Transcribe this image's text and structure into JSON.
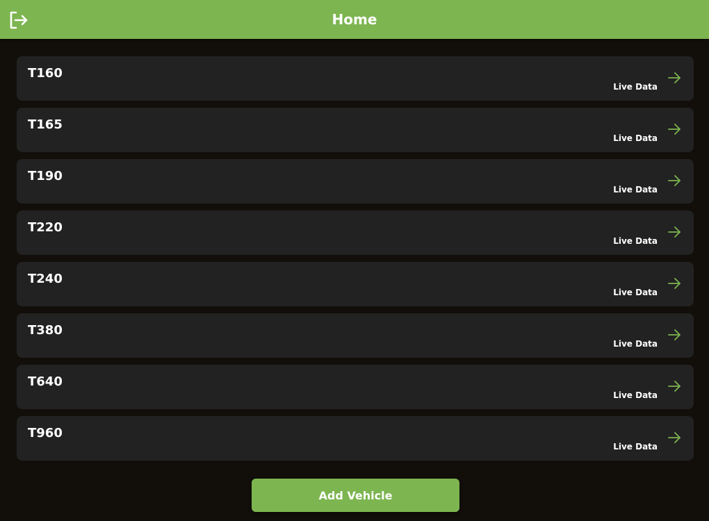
{
  "header": {
    "title": "Home",
    "logout_icon": "logout-icon"
  },
  "vehicles": [
    {
      "name": "T160",
      "link_label": "Live Data"
    },
    {
      "name": "T165",
      "link_label": "Live Data"
    },
    {
      "name": "T190",
      "link_label": "Live Data"
    },
    {
      "name": "T220",
      "link_label": "Live Data"
    },
    {
      "name": "T240",
      "link_label": "Live Data"
    },
    {
      "name": "T380",
      "link_label": "Live Data"
    },
    {
      "name": "T640",
      "link_label": "Live Data"
    },
    {
      "name": "T960",
      "link_label": "Live Data"
    }
  ],
  "actions": {
    "add_vehicle_label": "Add Vehicle"
  },
  "colors": {
    "accent": "#7db550",
    "background": "#120f0b",
    "card": "#222222",
    "text": "#ffffff"
  }
}
